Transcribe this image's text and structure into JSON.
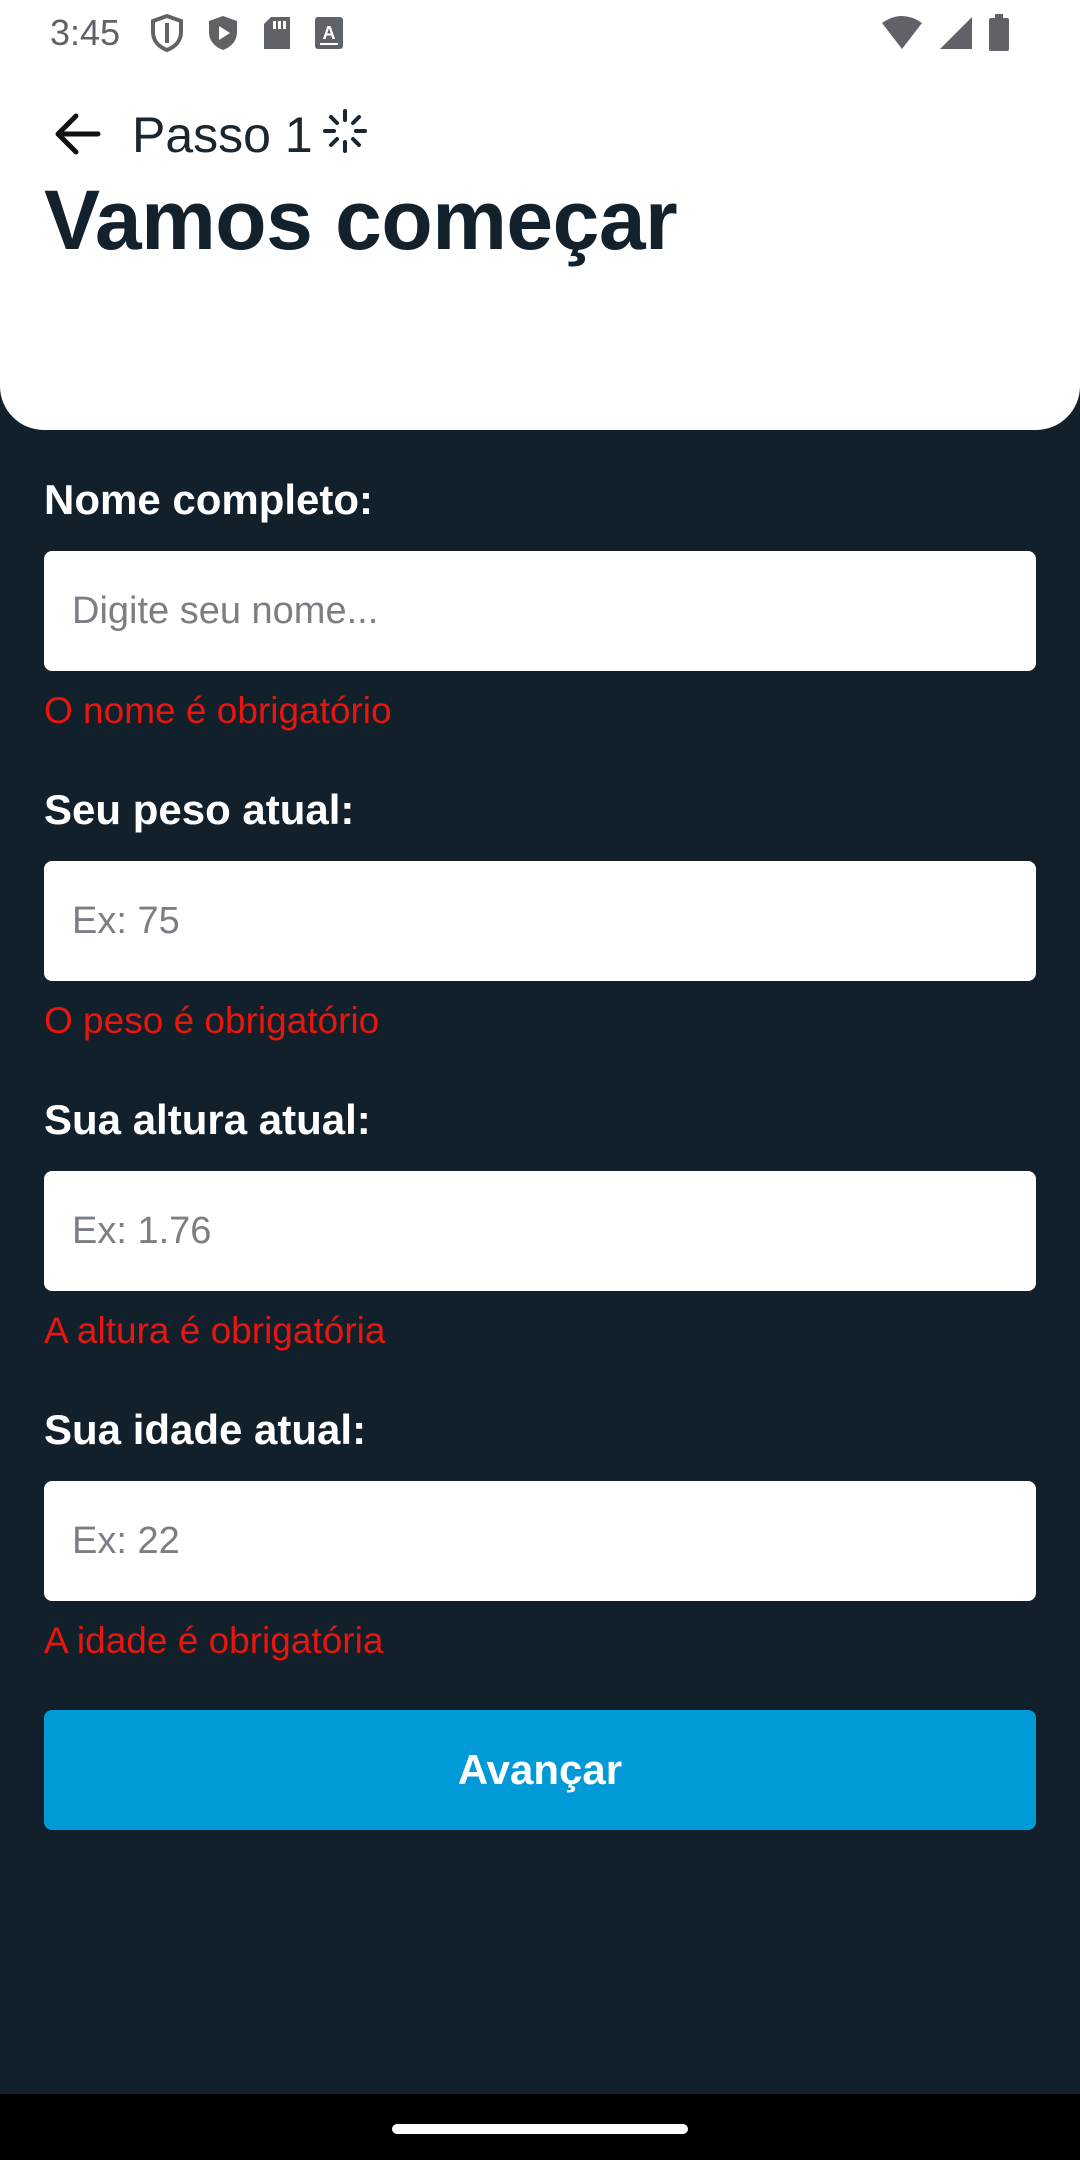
{
  "status_bar": {
    "time": "3:45",
    "left_icons": [
      "shield-icon",
      "play-protect-icon",
      "sd-card-icon",
      "keyboard-a-icon"
    ],
    "right_icons": [
      "wifi-icon",
      "cell-signal-icon",
      "battery-icon"
    ]
  },
  "header": {
    "step": "Passo 1",
    "title": "Vamos começar"
  },
  "form": {
    "name": {
      "label": "Nome completo:",
      "placeholder": "Digite seu nome...",
      "value": "",
      "error": "O nome é obrigatório"
    },
    "weight": {
      "label": "Seu peso atual:",
      "placeholder": "Ex: 75",
      "value": "",
      "error": "O peso é obrigatório"
    },
    "height": {
      "label": "Sua altura atual:",
      "placeholder": "Ex: 1.76",
      "value": "",
      "error": "A altura é obrigatória"
    },
    "age": {
      "label": "Sua idade atual:",
      "placeholder": "Ex: 22",
      "value": "",
      "error": "A idade é obrigatória"
    },
    "submit_label": "Avançar"
  },
  "colors": {
    "background": "#12202b",
    "header_bg": "#ffffff",
    "error": "#e8160c",
    "accent": "#009ad9"
  }
}
